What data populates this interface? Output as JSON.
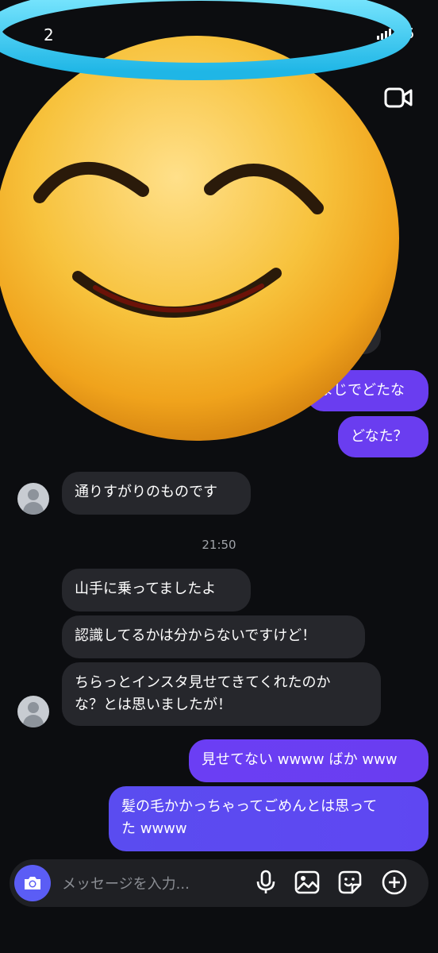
{
  "status": {
    "time": "2",
    "battery": "46"
  },
  "header": {
    "video_icon": "video-camera-icon"
  },
  "colors": {
    "background": "#0c0d10",
    "incoming_bubble": "#26272c",
    "outgoing_bubble": "#6a3df0",
    "accent": "#5b5df5",
    "halo": "#4fd6f2"
  },
  "messages": {
    "out_1": "まじでどたな",
    "out_2": "どなた？",
    "in_1": "通りすがりのものです",
    "timestamp": "21:50",
    "in_2": "山手に乗ってましたよ",
    "in_3": "認識してるかは分からないですけど！",
    "in_4": "ちらっとインスタ見せてきてくれたのか\nな？とは思いましたが！",
    "out_3": "見せてない wwww ばか www",
    "out_4": "髪の毛かかっちゃってごめんとは思って\nた wwww"
  },
  "composer": {
    "placeholder": "メッセージを入力...",
    "icons": [
      "camera-icon",
      "microphone-icon",
      "image-icon",
      "sticker-icon",
      "add-icon"
    ]
  }
}
